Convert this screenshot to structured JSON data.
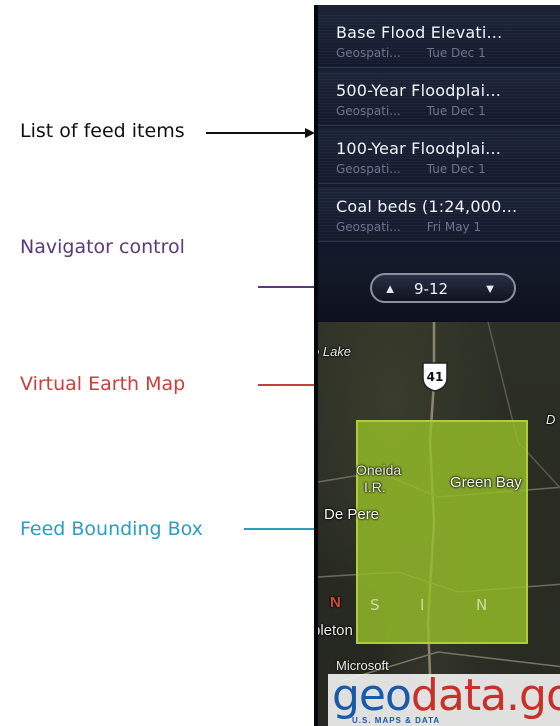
{
  "annotations": [
    {
      "label": "List of feed items",
      "color": "#111111"
    },
    {
      "label": "Navigator control",
      "color": "#5b3a7a"
    },
    {
      "label": "Virtual Earth Map",
      "color": "#c8403a"
    },
    {
      "label": "Feed Bounding Box",
      "color": "#2a9ec0"
    }
  ],
  "feed_items": [
    {
      "title": "Base Flood Elevati...",
      "source": "Geospati...",
      "date": "Tue Dec 1"
    },
    {
      "title": "500-Year Floodplai...",
      "source": "Geospati...",
      "date": "Tue Dec 1"
    },
    {
      "title": "100-Year Floodplai...",
      "source": "Geospati...",
      "date": "Tue Dec 1"
    },
    {
      "title": "Coal beds (1:24,000...",
      "source": "Geospati...",
      "date": "Fri May 1"
    }
  ],
  "navigator": {
    "up_icon": "triangle-up-icon",
    "down_icon": "triangle-down-icon",
    "range": "9-12"
  },
  "map": {
    "labels": {
      "lake": "o Lake",
      "oneida": "Oneida",
      "ir": "I.R.",
      "green_bay": "Green Bay",
      "de_pere": "De Pere",
      "appleton": "pleton",
      "d": "D"
    },
    "highway_shield": "41",
    "bbox_letters": [
      "N",
      "S",
      "I",
      "N"
    ],
    "provider": "Microsoft",
    "logo": {
      "prefix": "ge",
      "accent": "o",
      "suffix": "data.gov",
      "tagline": "U.S. MAPS & DATA"
    },
    "bbox_color": "#96be28"
  }
}
